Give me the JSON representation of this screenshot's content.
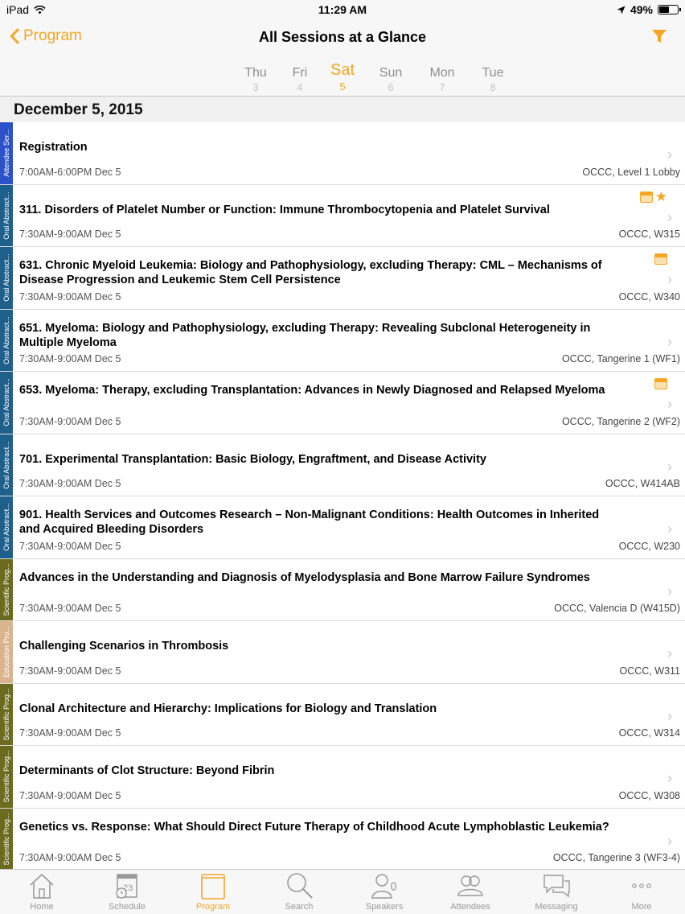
{
  "status": {
    "device": "iPad",
    "time": "11:29 AM",
    "battery": "49%"
  },
  "nav": {
    "back_label": "Program",
    "title": "All Sessions at a Glance"
  },
  "days": [
    {
      "name": "Thu",
      "num": "3"
    },
    {
      "name": "Fri",
      "num": "4"
    },
    {
      "name": "Sat",
      "num": "5"
    },
    {
      "name": "Sun",
      "num": "6"
    },
    {
      "name": "Mon",
      "num": "7"
    },
    {
      "name": "Tue",
      "num": "8"
    }
  ],
  "date_header": "December 5, 2015",
  "colors": {
    "accent": "#f5a623",
    "attendee": "#2b52c9",
    "oral": "#1f5f8c",
    "scientific": "#6b6a1e",
    "education": "#d9b48f"
  },
  "sessions": [
    {
      "tag": "Attendee Ser...",
      "title": "Registration",
      "time": "7:00AM-6:00PM  Dec 5",
      "location": "OCCC, Level 1 Lobby"
    },
    {
      "tag": "Oral Abstract...",
      "title": "311. Disorders of Platelet Number or Function: Immune Thrombocytopenia and Platelet Survival",
      "time": "7:30AM-9:00AM  Dec 5",
      "location": "OCCC, W315"
    },
    {
      "tag": "Oral Abstract...",
      "title": "631. Chronic Myeloid Leukemia: Biology and Pathophysiology, excluding Therapy: CML – Mechanisms of Disease Progression and Leukemic Stem Cell Persistence",
      "time": "7:30AM-9:00AM  Dec 5",
      "location": "OCCC, W340"
    },
    {
      "tag": "Oral Abstract...",
      "title": "651. Myeloma: Biology and Pathophysiology, excluding Therapy: Revealing Subclonal Heterogeneity in Multiple Myeloma",
      "time": "7:30AM-9:00AM  Dec 5",
      "location": "OCCC, Tangerine 1 (WF1)"
    },
    {
      "tag": "Oral Abstract...",
      "title": "653. Myeloma: Therapy, excluding Transplantation: Advances in Newly Diagnosed and Relapsed Myeloma",
      "time": "7:30AM-9:00AM  Dec 5",
      "location": "OCCC, Tangerine 2 (WF2)"
    },
    {
      "tag": "Oral Abstract...",
      "title": "701. Experimental Transplantation: Basic Biology, Engraftment, and Disease Activity",
      "time": "7:30AM-9:00AM  Dec 5",
      "location": "OCCC, W414AB"
    },
    {
      "tag": "Oral Abstract...",
      "title": "901. Health Services and Outcomes Research – Non-Malignant Conditions: Health Outcomes in Inherited and Acquired Bleeding Disorders",
      "time": "7:30AM-9:00AM  Dec 5",
      "location": "OCCC, W230"
    },
    {
      "tag": "Scientific Prog...",
      "title": "Advances in the Understanding and Diagnosis of Myelodysplasia and Bone Marrow Failure Syndromes",
      "time": "7:30AM-9:00AM  Dec 5",
      "location": "OCCC, Valencia D (W415D)"
    },
    {
      "tag": "Education Pro...",
      "title": "Challenging Scenarios in Thrombosis",
      "time": "7:30AM-9:00AM  Dec 5",
      "location": "OCCC, W311"
    },
    {
      "tag": "Scientific Prog...",
      "title": "Clonal Architecture and Hierarchy: Implications  for Biology and Translation",
      "time": "7:30AM-9:00AM  Dec 5",
      "location": "OCCC, W314"
    },
    {
      "tag": "Scientific Prog...",
      "title": "Determinants of Clot Structure: Beyond Fibrin",
      "time": "7:30AM-9:00AM  Dec 5",
      "location": "OCCC, W308"
    },
    {
      "tag": "Scientific Prog...",
      "title": "Genetics vs. Response: What Should Direct Future Therapy of Childhood Acute Lymphoblastic Leukemia?",
      "time": "7:30AM-9:00AM  Dec 5",
      "location": "OCCC, Tangerine 3 (WF3-4)"
    }
  ],
  "tabs": [
    {
      "label": "Home",
      "icon": "home-icon"
    },
    {
      "label": "Schedule",
      "icon": "schedule-icon"
    },
    {
      "label": "Program",
      "icon": "program-icon"
    },
    {
      "label": "Search",
      "icon": "search-icon"
    },
    {
      "label": "Speakers",
      "icon": "speakers-icon"
    },
    {
      "label": "Attendees",
      "icon": "attendees-icon"
    },
    {
      "label": "Messaging",
      "icon": "messaging-icon"
    },
    {
      "label": "More",
      "icon": "more-icon"
    }
  ]
}
